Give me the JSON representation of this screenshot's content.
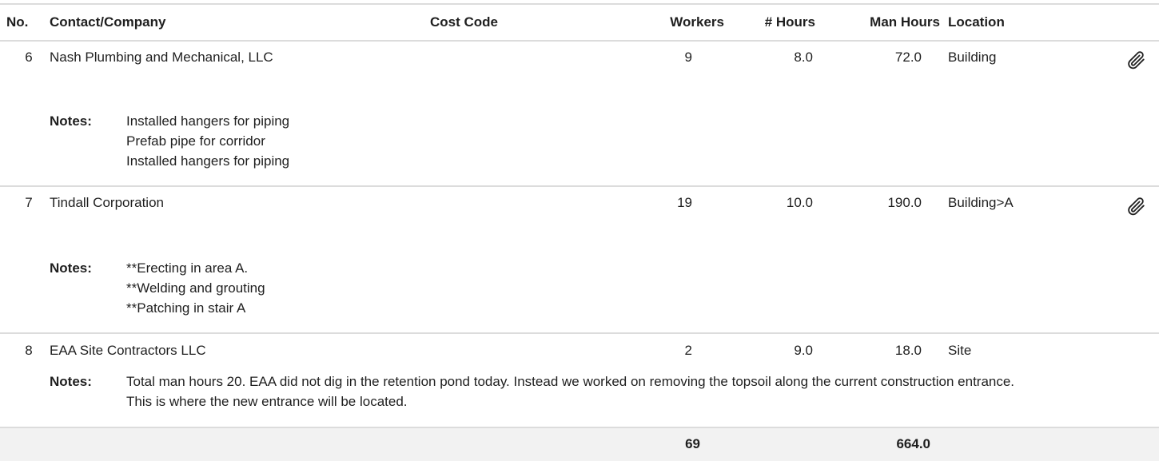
{
  "headers": {
    "no": "No.",
    "contact": "Contact/Company",
    "cost_code": "Cost Code",
    "workers": "Workers",
    "hours": "# Hours",
    "man_hours": "Man Hours",
    "location": "Location"
  },
  "notes_label": "Notes:",
  "rows": [
    {
      "no": "6",
      "contact": "Nash Plumbing and Mechanical, LLC",
      "cost_code": "",
      "workers": "9",
      "hours": "8.0",
      "man_hours": "72.0",
      "location": "Building",
      "attachment_icon": "paperclip-icon",
      "notes": [
        "Installed hangers for piping",
        "Prefab pipe for corridor",
        "Installed hangers for piping"
      ]
    },
    {
      "no": "7",
      "contact": "Tindall Corporation",
      "cost_code": "",
      "workers": "19",
      "hours": "10.0",
      "man_hours": "190.0",
      "location": "Building>A",
      "attachment_icon": "paperclip-icon",
      "notes": [
        "**Erecting in area A.",
        "**Welding and grouting",
        "**Patching in stair A"
      ]
    },
    {
      "no": "8",
      "contact": "EAA Site Contractors LLC",
      "cost_code": "",
      "workers": "2",
      "hours": "9.0",
      "man_hours": "18.0",
      "location": "Site",
      "notes": [
        "Total man hours 20. EAA did not dig in the retention pond today. Instead we worked on removing the topsoil along the current construction entrance. This is where the new entrance will be located."
      ]
    }
  ],
  "totals": {
    "workers": "69",
    "man_hours": "664.0"
  }
}
